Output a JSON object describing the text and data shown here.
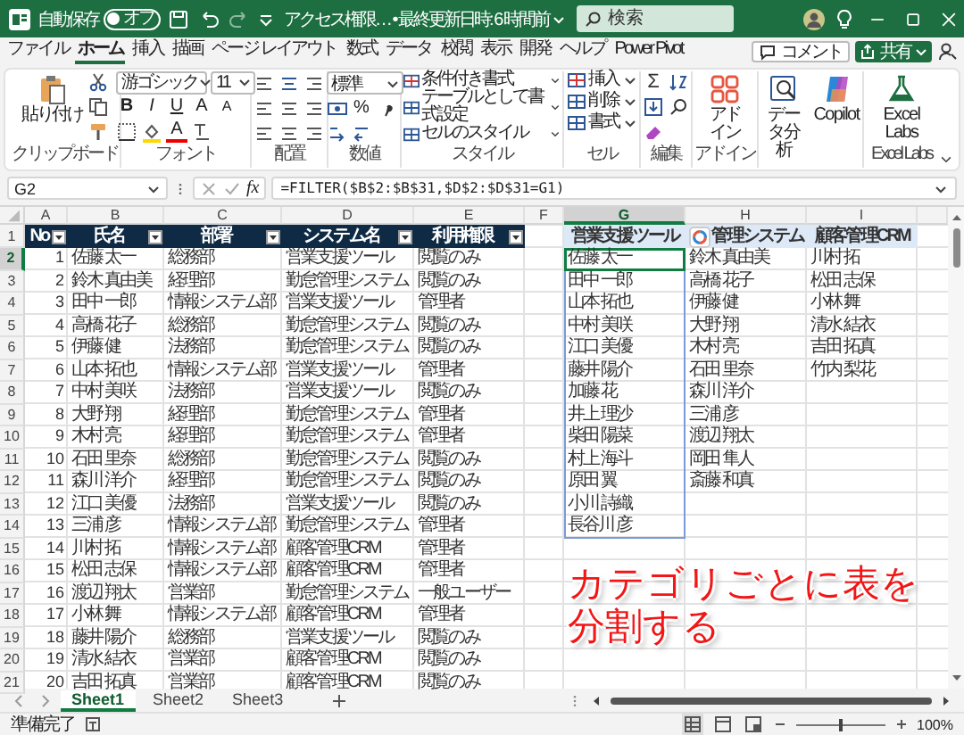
{
  "title_bar": {
    "autosave_label": "自動保存",
    "autosave": {
      "on": false,
      "label": "オフ"
    },
    "title": "アクセス権限… • 最終更新日時: 6 時間前",
    "search_placeholder": "検索"
  },
  "ribbon_tabs": [
    {
      "label": "ファイル",
      "selected": false
    },
    {
      "label": "ホーム",
      "selected": true
    },
    {
      "label": "挿入",
      "selected": false
    },
    {
      "label": "描画",
      "selected": false
    },
    {
      "label": "ページ レイアウト",
      "selected": false
    },
    {
      "label": "数式",
      "selected": false
    },
    {
      "label": "データ",
      "selected": false
    },
    {
      "label": "校閲",
      "selected": false
    },
    {
      "label": "表示",
      "selected": false
    },
    {
      "label": "開発",
      "selected": false
    },
    {
      "label": "ヘルプ",
      "selected": false
    },
    {
      "label": "Power Pivot",
      "selected": false
    }
  ],
  "comment_button": "コメント",
  "share_button": "共有",
  "ribbon_groups": [
    {
      "kind": "clipboard",
      "label": "クリップボード",
      "paste": "貼り付け"
    },
    {
      "kind": "font",
      "label": "フォント",
      "font_name": "游ゴシック",
      "font_size": "11",
      "styles": [
        "B",
        "I",
        "U"
      ],
      "size_buttons": [
        "A",
        "A"
      ],
      "color_glyph": "A"
    },
    {
      "kind": "alignment",
      "label": "配置"
    },
    {
      "kind": "number",
      "label": "数値",
      "format": "標準",
      "percent": "%"
    },
    {
      "kind": "styles",
      "label": "スタイル",
      "items": [
        "条件付き書式",
        "テーブルとして書式設定",
        "セルのスタイル"
      ]
    },
    {
      "kind": "cells",
      "label": "セル",
      "items": [
        "挿入",
        "削除",
        "書式"
      ]
    },
    {
      "kind": "editing",
      "label": "編集",
      "sum": "Σ"
    },
    {
      "kind": "addin",
      "label": "アドイン",
      "button": "アドイン"
    },
    {
      "kind": "analysis",
      "buttons": [
        "データ分析",
        "Copilot"
      ]
    },
    {
      "kind": "labs",
      "label": "Excel Labs",
      "button": "Excel Labs"
    }
  ],
  "formula_bar": {
    "name_box": "G2",
    "fx_label": "fx",
    "formula": "=FILTER($B$2:$B$31,$D$2:$D$31=G1)"
  },
  "columns": [
    {
      "label": "A",
      "selected": false
    },
    {
      "label": "B",
      "selected": false
    },
    {
      "label": "C",
      "selected": false
    },
    {
      "label": "D",
      "selected": false
    },
    {
      "label": "E",
      "selected": false
    },
    {
      "label": "F",
      "selected": false
    },
    {
      "label": "G",
      "selected": true
    },
    {
      "label": "H",
      "selected": false
    },
    {
      "label": "I",
      "selected": false
    }
  ],
  "row_headers": [
    {
      "label": "1",
      "selected": false
    },
    {
      "label": "2",
      "selected": true
    },
    {
      "label": "3",
      "selected": false
    },
    {
      "label": "4",
      "selected": false
    },
    {
      "label": "5",
      "selected": false
    },
    {
      "label": "6",
      "selected": false
    },
    {
      "label": "7",
      "selected": false
    },
    {
      "label": "8",
      "selected": false
    },
    {
      "label": "9",
      "selected": false
    },
    {
      "label": "10",
      "selected": false
    },
    {
      "label": "11",
      "selected": false
    },
    {
      "label": "12",
      "selected": false
    },
    {
      "label": "13",
      "selected": false
    },
    {
      "label": "14",
      "selected": false
    },
    {
      "label": "15",
      "selected": false
    },
    {
      "label": "16",
      "selected": false
    },
    {
      "label": "17",
      "selected": false
    },
    {
      "label": "18",
      "selected": false
    },
    {
      "label": "19",
      "selected": false
    },
    {
      "label": "20",
      "selected": false
    },
    {
      "label": "21",
      "selected": false
    }
  ],
  "table": {
    "headers": [
      "No",
      "氏名",
      "部署",
      "システム名",
      "利用権限"
    ],
    "rows": [
      [
        "1",
        "佐藤 太一",
        "総務部",
        "営業支援ツール",
        "閲覧のみ"
      ],
      [
        "2",
        "鈴木 真由美",
        "経理部",
        "勤怠管理システム",
        "閲覧のみ"
      ],
      [
        "3",
        "田中 一郎",
        "情報システム部",
        "営業支援ツール",
        "管理者"
      ],
      [
        "4",
        "高橋 花子",
        "総務部",
        "勤怠管理システム",
        "閲覧のみ"
      ],
      [
        "5",
        "伊藤 健",
        "法務部",
        "勤怠管理システム",
        "閲覧のみ"
      ],
      [
        "6",
        "山本 拓也",
        "情報システム部",
        "営業支援ツール",
        "管理者"
      ],
      [
        "7",
        "中村 美咲",
        "法務部",
        "営業支援ツール",
        "閲覧のみ"
      ],
      [
        "8",
        "大野 翔",
        "経理部",
        "勤怠管理システム",
        "管理者"
      ],
      [
        "9",
        "木村 亮",
        "経理部",
        "勤怠管理システム",
        "管理者"
      ],
      [
        "10",
        "石田 里奈",
        "総務部",
        "勤怠管理システム",
        "閲覧のみ"
      ],
      [
        "11",
        "森川 洋介",
        "経理部",
        "勤怠管理システム",
        "閲覧のみ"
      ],
      [
        "12",
        "江口 美優",
        "法務部",
        "営業支援ツール",
        "閲覧のみ"
      ],
      [
        "13",
        "三浦 彦",
        "情報システム部",
        "勤怠管理システム",
        "管理者"
      ],
      [
        "14",
        "川村 拓",
        "情報システム部",
        "顧客管理CRM",
        "管理者"
      ],
      [
        "15",
        "松田 志保",
        "情報システム部",
        "顧客管理CRM",
        "管理者"
      ],
      [
        "16",
        "渡辺 翔太",
        "営業部",
        "勤怠管理システム",
        "一般ユーザー"
      ],
      [
        "17",
        "小林 舞",
        "情報システム部",
        "顧客管理CRM",
        "管理者"
      ],
      [
        "18",
        "藤井 陽介",
        "総務部",
        "営業支援ツール",
        "閲覧のみ"
      ],
      [
        "19",
        "清水 結衣",
        "営業部",
        "顧客管理CRM",
        "閲覧のみ"
      ],
      [
        "20",
        "吉田 拓真",
        "営業部",
        "顧客管理CRM",
        "閲覧のみ"
      ]
    ]
  },
  "spill_lists": [
    {
      "header": "営業支援ツール",
      "copilot_badge": false,
      "names": [
        "佐藤 太一",
        "田中 一郎",
        "山本 拓也",
        "中村 美咲",
        "江口 美優",
        "藤井 陽介",
        "加藤 花",
        "井上 理沙",
        "柴田 陽菜",
        "村上 海斗",
        "原田 翼",
        "小川 詩織",
        "長谷川 彦"
      ]
    },
    {
      "header": "管理システム",
      "copilot_badge": true,
      "names": [
        "鈴木 真由美",
        "高橋 花子",
        "伊藤 健",
        "大野 翔",
        "木村 亮",
        "石田 里奈",
        "森川 洋介",
        "三浦 彦",
        "渡辺 翔太",
        "岡田 隼人",
        "斎藤 和真"
      ]
    },
    {
      "header": "顧客管理CRM",
      "copilot_badge": false,
      "names": [
        "川村 拓",
        "松田 志保",
        "小林 舞",
        "清水 結衣",
        "吉田 拓真",
        "竹内 梨花"
      ]
    }
  ],
  "annotation": "カテゴリごとに表を分割する",
  "sheet_tabs": [
    {
      "label": "Sheet1",
      "selected": true
    },
    {
      "label": "Sheet2",
      "selected": false
    },
    {
      "label": "Sheet3",
      "selected": false
    }
  ],
  "status_bar": {
    "status": "準備完了",
    "zoom": {
      "level": 0.5,
      "reading": "100%"
    }
  }
}
